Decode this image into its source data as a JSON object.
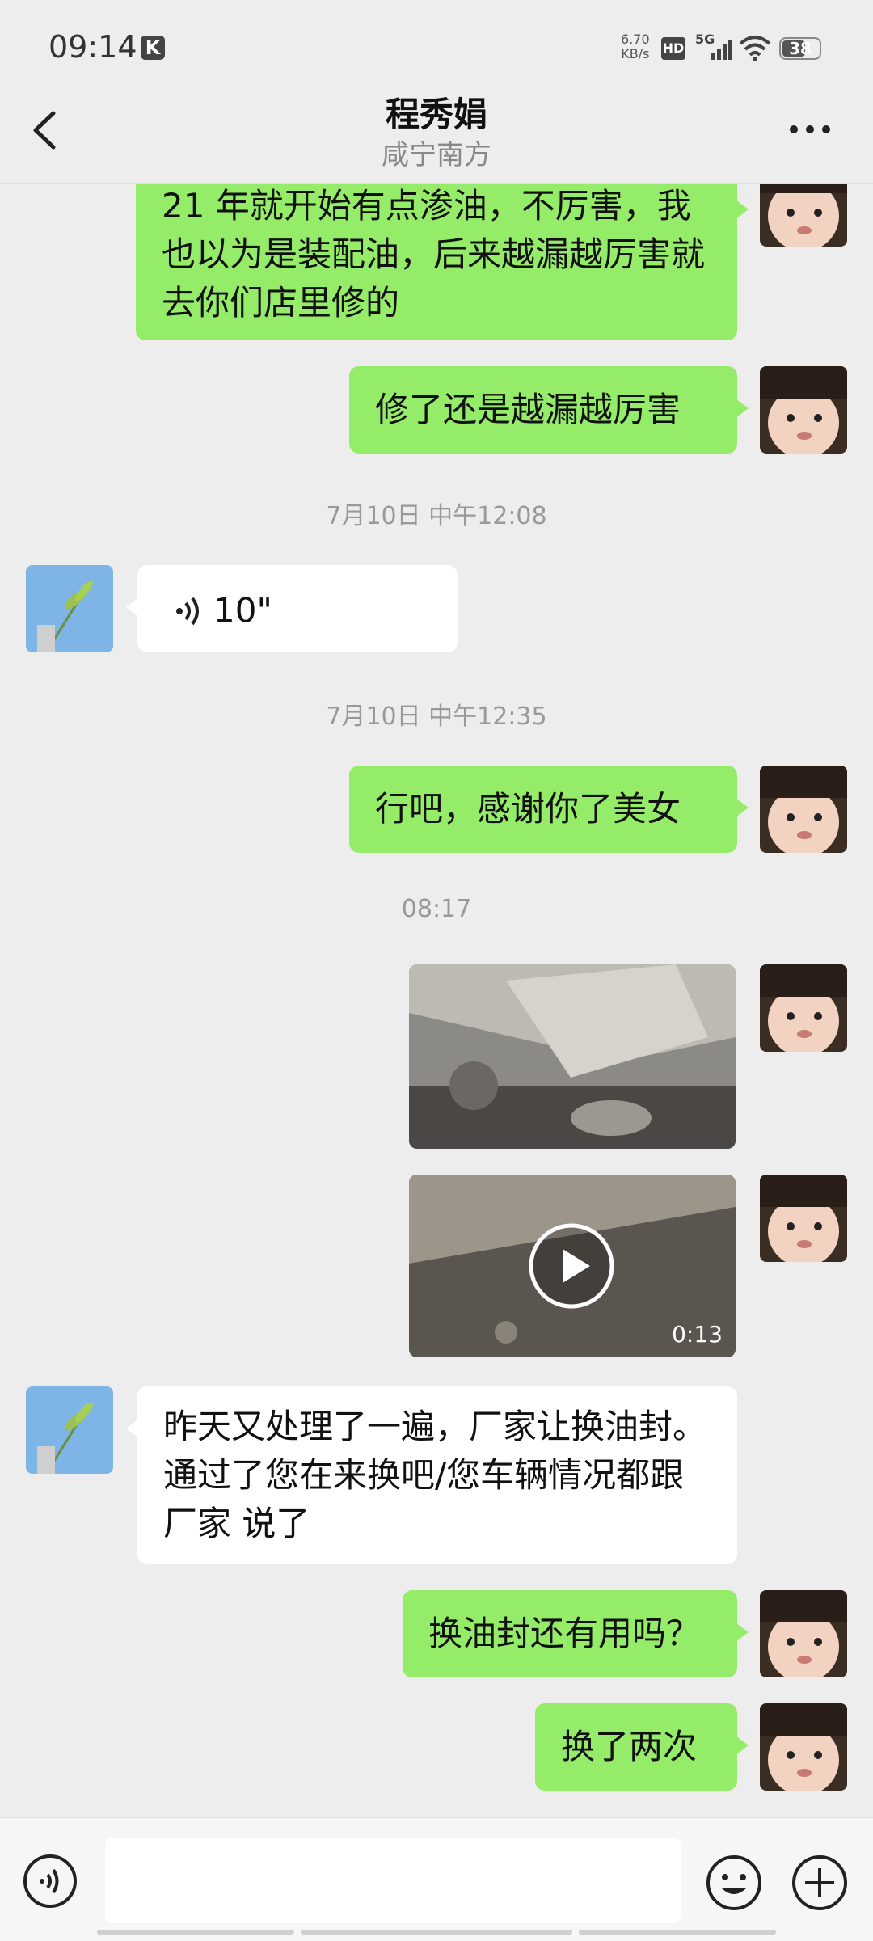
{
  "status_bar": {
    "time": "09:14",
    "k_badge": "K",
    "speed_value": "6.70",
    "speed_unit": "KB/s",
    "hd": "HD",
    "network": "5G",
    "battery": "38"
  },
  "header": {
    "title": "程秀娟",
    "subtitle": "咸宁南方"
  },
  "messages": [
    {
      "text": "21 年就开始有点渗油，不厉害，我也以为是装配油，后来越漏越厉害就去你们店里修的"
    },
    {
      "text": "修了还是越漏越厉害"
    },
    {
      "text": "7月10日  中午12:08"
    },
    {
      "text": "10\""
    },
    {
      "text": "7月10日  中午12:35"
    },
    {
      "text": "行吧，感谢你了美女"
    },
    {
      "text": "08:17"
    },
    {
      "duration": "0:13"
    },
    {
      "text": "昨天又处理了一遍，厂家让换油封。通过了您在来换吧/您车辆情况都跟厂家  说了"
    },
    {
      "text": "换油封还有用吗？"
    },
    {
      "text": "换了两次"
    }
  ],
  "icons": {
    "back": "chevron-left-icon",
    "more": "more-dots-icon",
    "voice": "voice-icon",
    "emoji": "emoji-icon",
    "plus": "plus-icon",
    "play": "play-icon"
  },
  "colors": {
    "my_bubble": "#95ec69",
    "other_bubble": "#ffffff",
    "background": "#ededed"
  }
}
